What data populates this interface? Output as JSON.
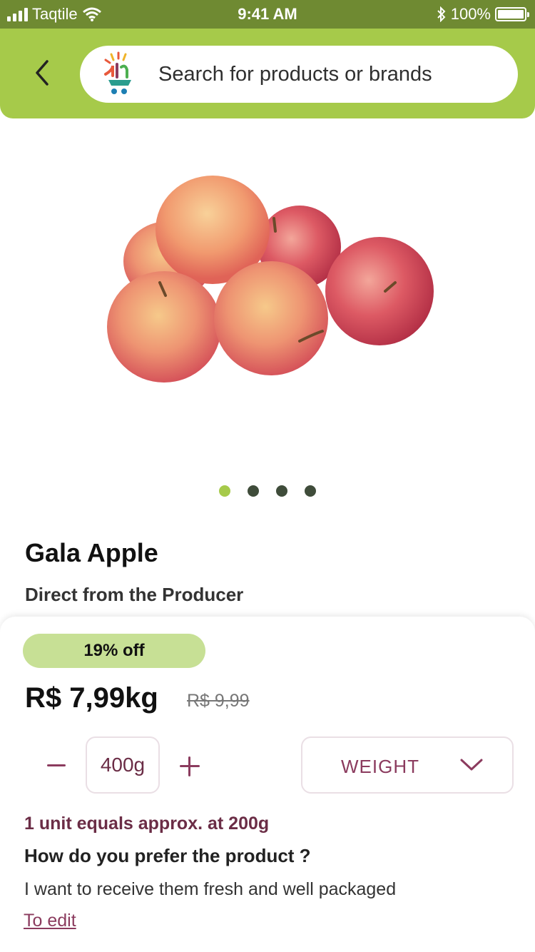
{
  "status_bar": {
    "carrier": "Taqtile",
    "time": "9:41 AM",
    "battery": "100%"
  },
  "search": {
    "placeholder": "Search for products or brands"
  },
  "carousel": {
    "count": 4,
    "active_index": 0
  },
  "product": {
    "name": "Gala Apple",
    "origin": "Direct from the Producer",
    "discount": "19% off",
    "price": "R$ 7,99kg",
    "old_price": "R$ 9,99",
    "quantity": "400g",
    "unit_select": "WEIGHT",
    "unit_note": "1 unit equals approx. at 200g",
    "preference_question": "How do you prefer the product ?",
    "preference_answer": "I want to receive them fresh and well packaged",
    "edit_link": "To edit"
  },
  "colors": {
    "header_green": "#a6ca4a",
    "status_green": "#6f8a32",
    "accent_wine": "#8b3b5e",
    "discount_bg": "#c7e095"
  }
}
